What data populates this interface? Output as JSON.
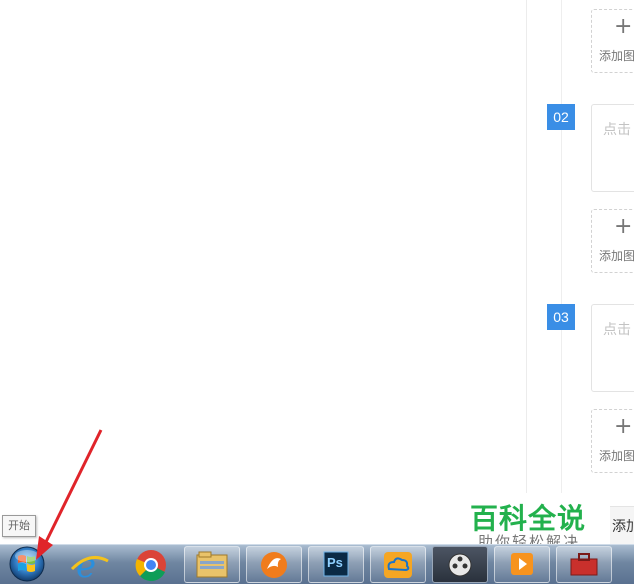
{
  "steps": [
    {
      "number": "02",
      "placeholder": "点击"
    },
    {
      "number": "03",
      "placeholder": "点击"
    }
  ],
  "add_image_labels": [
    "添加图",
    "添加图",
    "添加图"
  ],
  "add_step_label": "添加",
  "watermark": {
    "title": "百科全说",
    "subtitle": "助你轻松解决"
  },
  "taskbar": {
    "start_tooltip": "开始",
    "apps": [
      "start-orb",
      "internet-explorer",
      "chrome",
      "file-explorer",
      "fox-browser",
      "photoshop",
      "cloud-app",
      "media-player",
      "video-player",
      "toolbox"
    ],
    "photoshop_label": "Ps"
  },
  "colors": {
    "badge": "#3a8ee6",
    "watermark": "#23b14d",
    "arrow": "#e0242a"
  }
}
